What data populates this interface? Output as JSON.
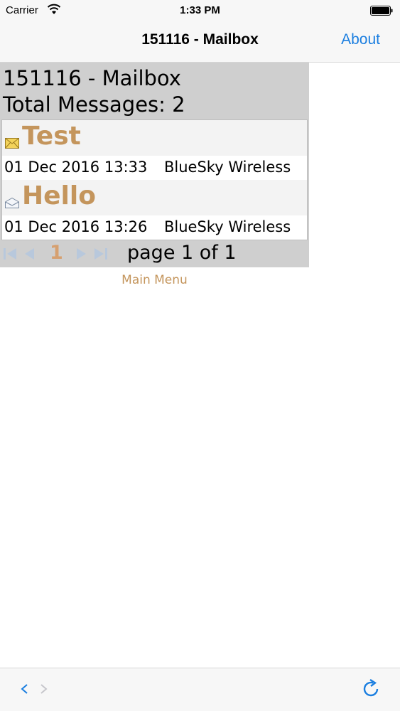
{
  "status": {
    "carrier": "Carrier",
    "time": "1:33 PM"
  },
  "nav": {
    "title": "151116 - Mailbox",
    "about_label": "About",
    "accent_color": "#1a7ee0"
  },
  "mailbox": {
    "title": "151116 - Mailbox",
    "total": "Total Messages: 2",
    "messages": [
      {
        "subject": "Test",
        "date": "01 Dec 2016 13:33",
        "from": "BlueSky Wireless",
        "icon": "envelope-unread-icon"
      },
      {
        "subject": "Hello",
        "date": "01 Dec 2016 13:26",
        "from": "BlueSky Wireless",
        "icon": "envelope-read-icon"
      }
    ],
    "pager": {
      "current": "1",
      "text": "page 1 of 1"
    },
    "main_menu": "Main Menu",
    "link_color": "#c4955c"
  },
  "toolbar": {
    "icons": [
      "chevron-left-icon",
      "chevron-right-icon",
      "refresh-icon"
    ]
  }
}
